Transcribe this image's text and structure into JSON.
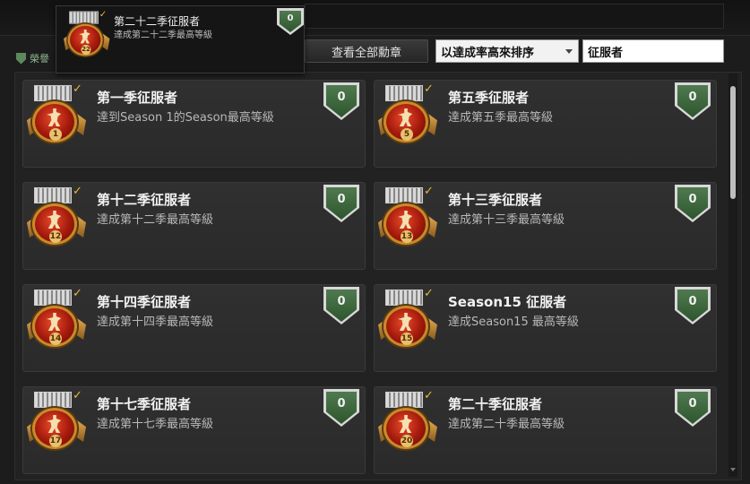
{
  "filter_tab": {
    "label": "榮譽"
  },
  "toolbar": {
    "view_all_label": "查看全部勳章",
    "sort_value": "以達成率高來排序",
    "search_value": "征服者"
  },
  "tooltip": {
    "title": "第二十二季征服者",
    "desc": "達成第二十二季最高等級",
    "count": "0",
    "medal_num": "22"
  },
  "achievements": [
    {
      "title": "第一季征服者",
      "desc": "達到Season 1的Season最高等級",
      "count": "0",
      "medal_num": "1"
    },
    {
      "title": "第五季征服者",
      "desc": "達成第五季最高等級",
      "count": "0",
      "medal_num": "5"
    },
    {
      "title": "第十二季征服者",
      "desc": "達成第十二季最高等級",
      "count": "0",
      "medal_num": "12"
    },
    {
      "title": "第十三季征服者",
      "desc": "達成第十三季最高等級",
      "count": "0",
      "medal_num": "13"
    },
    {
      "title": "第十四季征服者",
      "desc": "達成第十四季最高等級",
      "count": "0",
      "medal_num": "14"
    },
    {
      "title": "Season15 征服者",
      "desc": "達成Season15 最高等級",
      "count": "0",
      "medal_num": "15"
    },
    {
      "title": "第十七季征服者",
      "desc": "達成第十七季最高等級",
      "count": "0",
      "medal_num": "17"
    },
    {
      "title": "第二十季征服者",
      "desc": "達成第二十季最高等級",
      "count": "0",
      "medal_num": "20"
    }
  ],
  "colors": {
    "accent_gold": "#e8b838",
    "badge_green": "#4f7a4f",
    "medal_red": "#a51a0c"
  },
  "icons": {
    "badge": "shield-badge-icon",
    "medal": "conqueror-medal-icon",
    "check": "checkmark-icon"
  }
}
